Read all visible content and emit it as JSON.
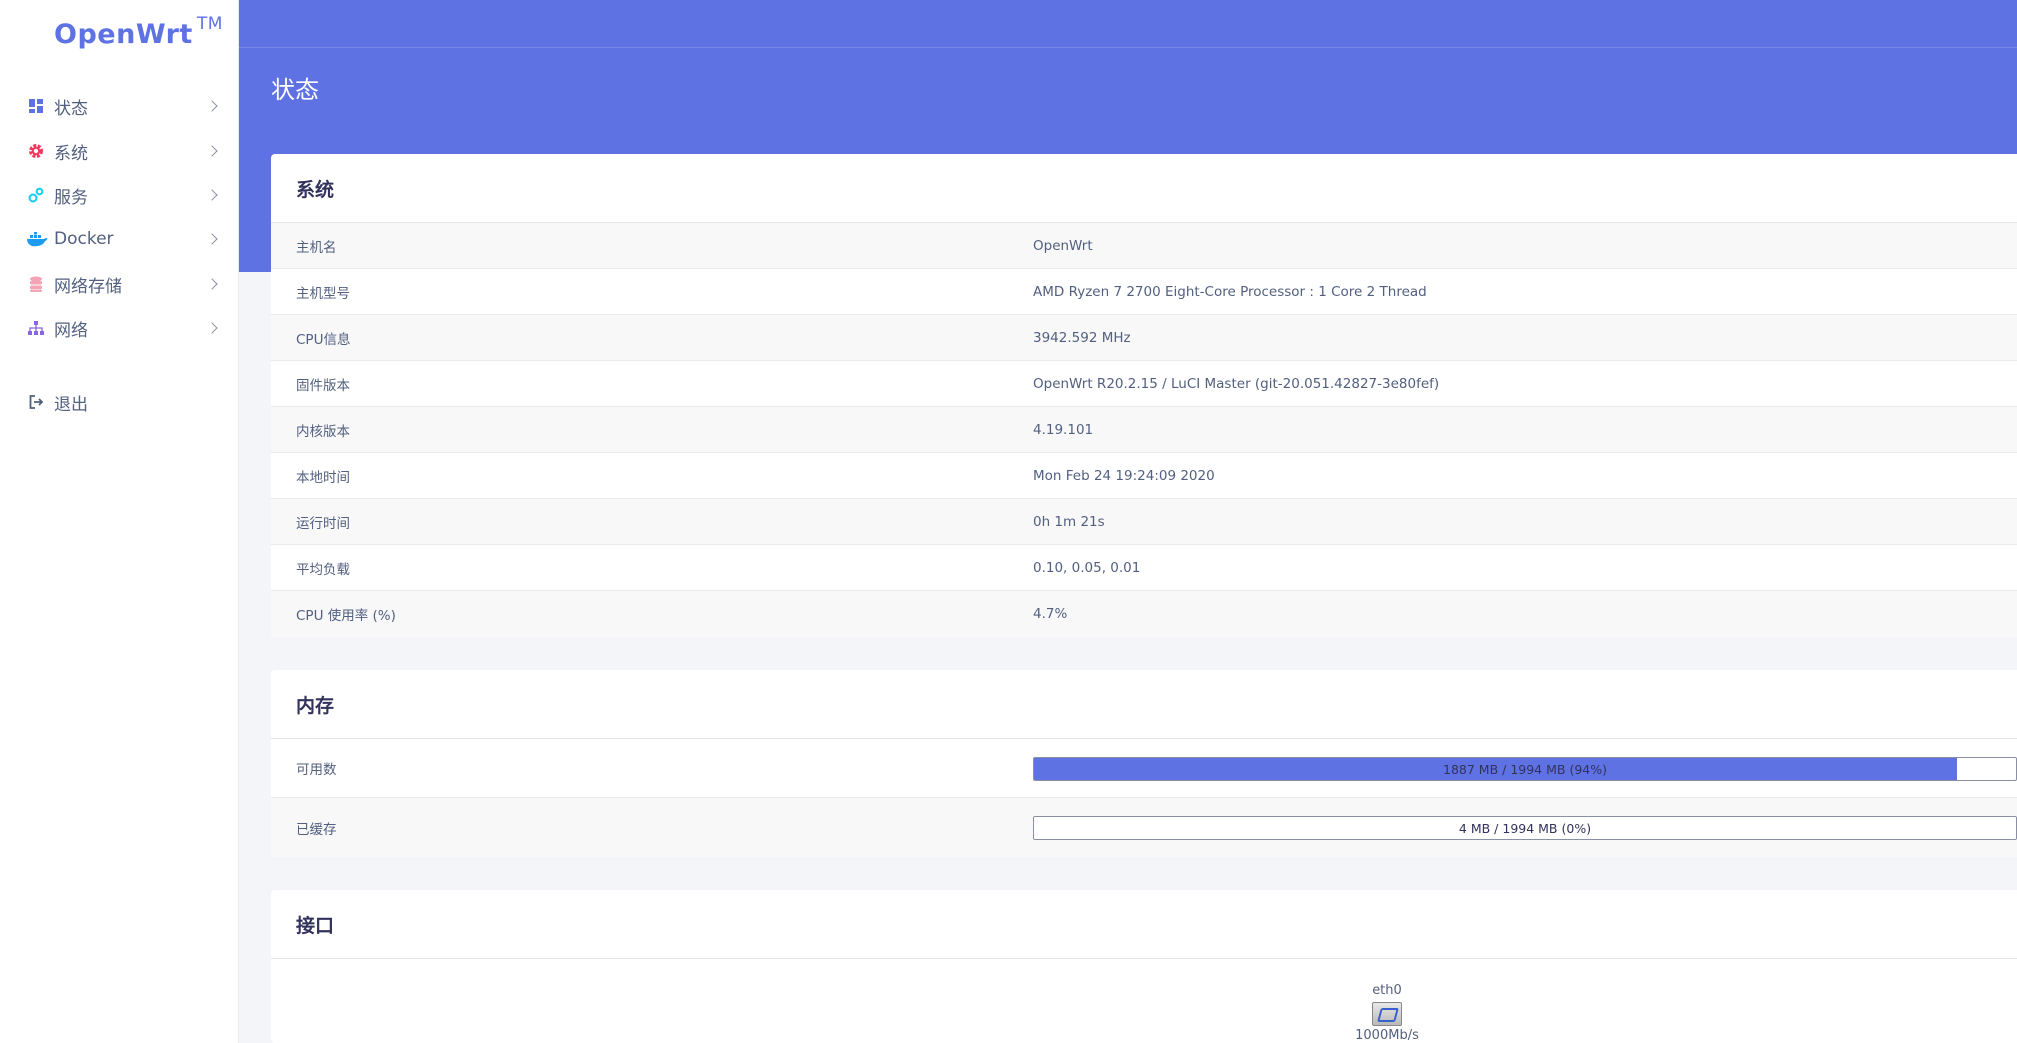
{
  "brand": {
    "name": "OpenWrt",
    "tm": "TM"
  },
  "sidebar": {
    "items": [
      {
        "label": "状态",
        "icon": "dashboard-icon",
        "color": "#5e72e4"
      },
      {
        "label": "系统",
        "icon": "gear-icon",
        "color": "#f5365c"
      },
      {
        "label": "服务",
        "icon": "cogs-icon",
        "color": "#11cdef"
      },
      {
        "label": "Docker",
        "icon": "docker-icon",
        "color": "#1d9bf0"
      },
      {
        "label": "网络存储",
        "icon": "database-icon",
        "color": "#f3a4b5"
      },
      {
        "label": "网络",
        "icon": "sitemap-icon",
        "color": "#8965e0"
      }
    ],
    "logout": {
      "label": "退出",
      "icon": "sign-out-icon"
    }
  },
  "header": {
    "title": "状态"
  },
  "system": {
    "title": "系统",
    "rows": [
      {
        "key": "主机名",
        "value": "OpenWrt"
      },
      {
        "key": "主机型号",
        "value": "AMD Ryzen 7 2700 Eight-Core Processor : 1 Core 2 Thread"
      },
      {
        "key": "CPU信息",
        "value": "3942.592 MHz"
      },
      {
        "key": "固件版本",
        "value": "OpenWrt R20.2.15 / LuCI Master (git-20.051.42827-3e80fef)"
      },
      {
        "key": "内核版本",
        "value": "4.19.101"
      },
      {
        "key": "本地时间",
        "value": "Mon Feb 24 19:24:09 2020"
      },
      {
        "key": "运行时间",
        "value": "0h 1m 21s"
      },
      {
        "key": "平均负载",
        "value": "0.10, 0.05, 0.01"
      },
      {
        "key": "CPU 使用率 (%)",
        "value": "4.7%"
      }
    ]
  },
  "memory": {
    "title": "内存",
    "rows": [
      {
        "key": "可用数",
        "value": "1887 MB / 1994 MB (94%)",
        "fraction": 0.94
      },
      {
        "key": "已缓存",
        "value": "4 MB / 1994 MB (0%)",
        "fraction": 0.0
      }
    ]
  },
  "interfaces": {
    "title": "接口",
    "items": [
      {
        "name": "eth0",
        "speed": "1000Mb/s"
      }
    ]
  },
  "colors": {
    "accent": "#5e72e4",
    "background": "#f4f5f9"
  }
}
